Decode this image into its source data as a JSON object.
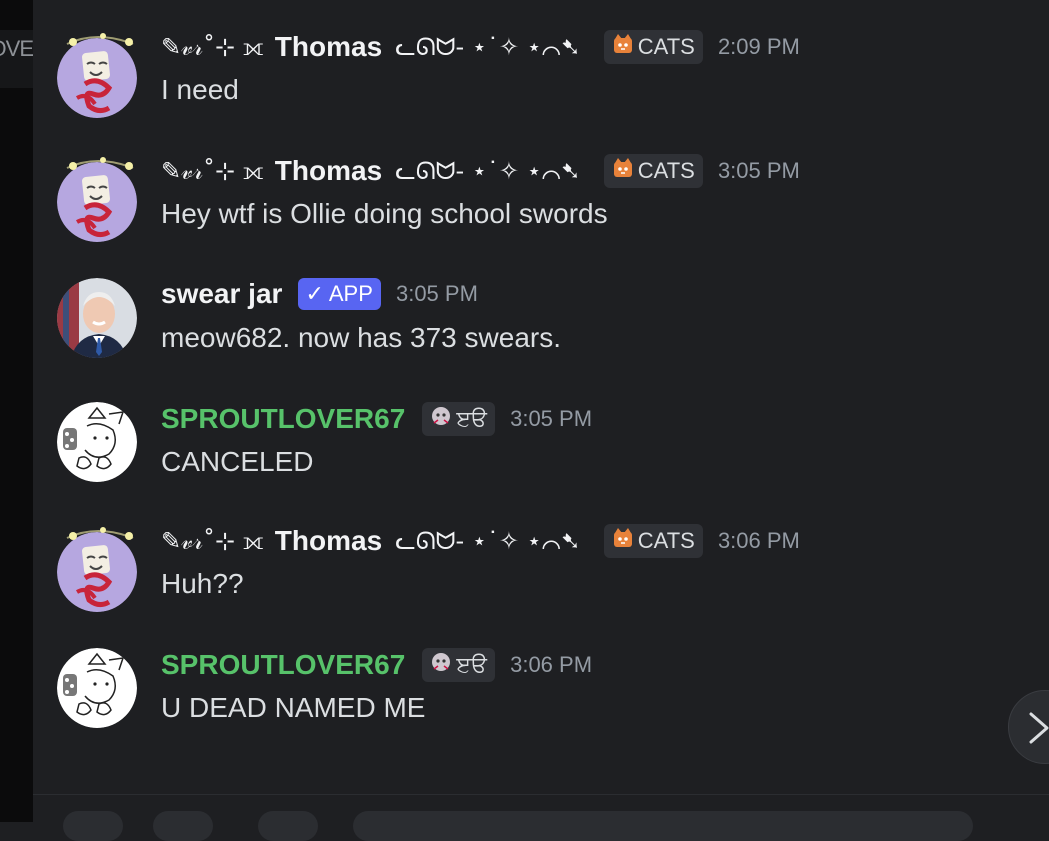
{
  "sidebar": {
    "partial_label": "OVE"
  },
  "messages": [
    {
      "author": "Thomas",
      "decor_before": "✎𝓋𝓇˚⊹ ⟗",
      "decor_after": "ᓚᘏᗢ- ⋆˙✧ ⋆⌒➷",
      "tag": "CATS",
      "time": "2:09 PM",
      "text": "I need",
      "avatar": "drawing-avatar",
      "name_color": "#f2f3f5"
    },
    {
      "author": "Thomas",
      "decor_before": "✎𝓋𝓇˚⊹ ⟗",
      "decor_after": "ᓚᘏᗢ- ⋆˙✧ ⋆⌒➷",
      "tag": "CATS",
      "time": "3:05 PM",
      "text": "Hey wtf is Ollie doing school swords",
      "avatar": "drawing-avatar",
      "name_color": "#f2f3f5"
    },
    {
      "author": "swear jar",
      "badge": "✓ APP",
      "time": "3:05 PM",
      "text": "meow682. now has 373 swears.",
      "avatar": "portrait-avatar",
      "name_color": "#f2f3f5"
    },
    {
      "author": "SPROUTLOVER67",
      "tag": "ੲੳ",
      "time": "3:05 PM",
      "text": "CANCELED",
      "avatar": "sketch-cat-avatar",
      "name_color": "#57c26a"
    },
    {
      "author": "Thomas",
      "decor_before": "✎𝓋𝓇˚⊹ ⟗",
      "decor_after": "ᓚᘏᗢ- ⋆˙✧ ⋆⌒➷",
      "tag": "CATS",
      "time": "3:06 PM",
      "text": "Huh??",
      "avatar": "drawing-avatar",
      "name_color": "#f2f3f5"
    },
    {
      "author": "SPROUTLOVER67",
      "tag": "ੲੳ",
      "time": "3:06 PM",
      "text": "U DEAD NAMED ME",
      "avatar": "sketch-cat-avatar",
      "name_color": "#57c26a"
    }
  ],
  "colors": {
    "background": "#1e1f22",
    "app_badge": "#5865f2",
    "green_name": "#57c26a",
    "timestamp": "#949ba4"
  },
  "icons": {
    "jump": "chevron-right-icon",
    "cat_tag": "orange-cat-icon",
    "sprout_tag": "creature-icon"
  }
}
